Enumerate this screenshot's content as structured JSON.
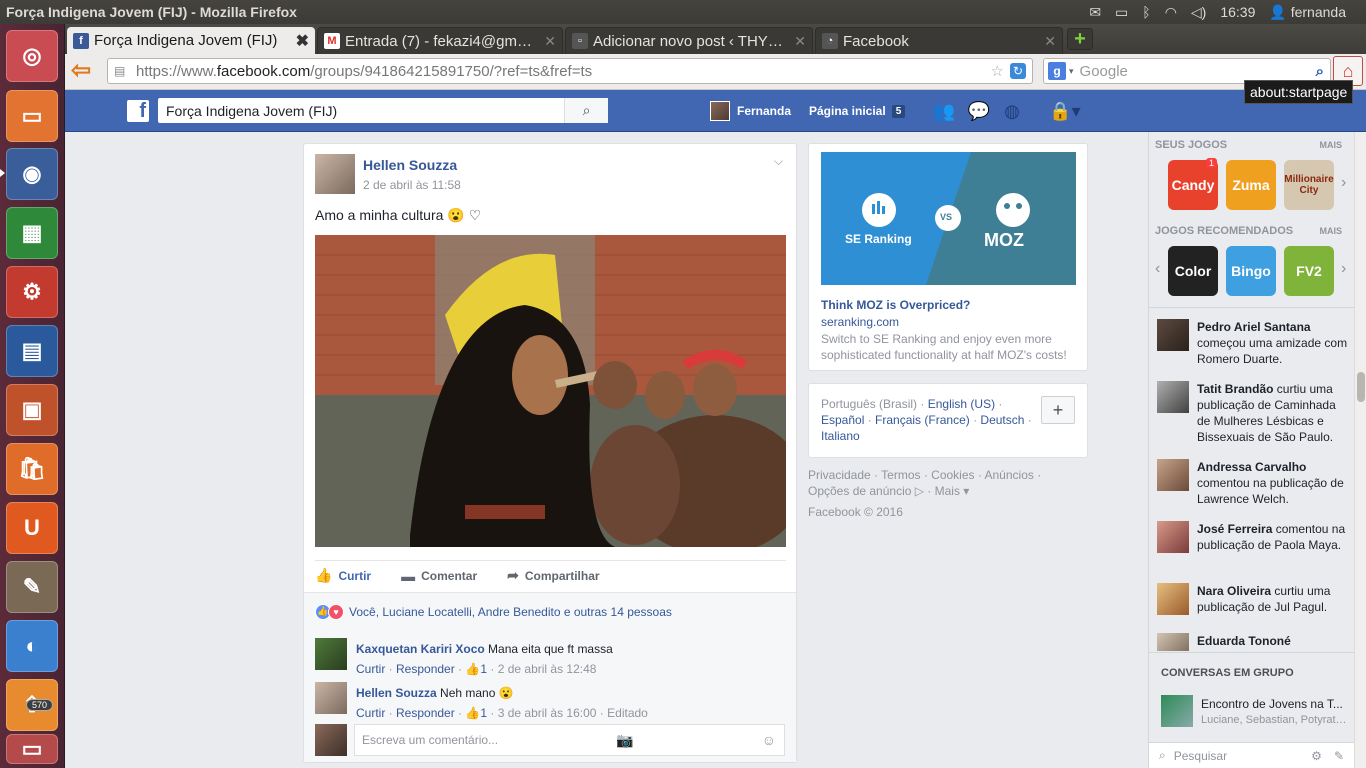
{
  "window": {
    "title": "Força Indigena Jovem (FIJ) - Mozilla Firefox"
  },
  "indicators": {
    "time": "16:39",
    "user": "fernanda"
  },
  "launcher": {
    "badge": "570"
  },
  "tabs": [
    {
      "label": "Força Indigena Jovem (FIJ)",
      "active": true,
      "favicon": "facebook-icon"
    },
    {
      "label": "Entrada (7) - fekazi4@gmail...",
      "active": false,
      "favicon": "gmail-icon"
    },
    {
      "label": "Adicionar novo post ‹ THYD...",
      "active": false,
      "favicon": "wordpress-icon"
    },
    {
      "label": "Facebook",
      "active": false,
      "favicon": "facebook-icon"
    }
  ],
  "nav": {
    "url_prefix": "https://www.",
    "url_domain": "facebook.com",
    "url_path": "/groups/941864215891750/?ref=ts&fref=ts",
    "search_placeholder": "Google",
    "tooltip": "about:startpage"
  },
  "fb": {
    "search_value": "Força Indigena Jovem (FIJ)",
    "user_name": "Fernanda",
    "home_label": "Página inicial",
    "home_count": "5"
  },
  "post": {
    "author": "Hellen Souzza",
    "time": "2 de abril às 11:58",
    "message": "Amo a minha cultura 😮 ♡",
    "actions": {
      "like": "Curtir",
      "comment": "Comentar",
      "share": "Compartilhar"
    },
    "likes_text": "Você, Luciane Locatelli, Andre Benedito e outras 14 pessoas",
    "comments": [
      {
        "name": "Kaxquetan Kariri Xoco",
        "text": "Mana eita que ft massa",
        "reply": "Responder",
        "like": "Curtir",
        "count": "1",
        "time": "2 de abril às 12:48",
        "edited": ""
      },
      {
        "name": "Hellen Souzza",
        "text": "Neh mano 😮",
        "reply": "Responder",
        "like": "Curtir",
        "count": "1",
        "time": "3 de abril às 16:00",
        "edited": "Editado"
      }
    ],
    "comment_placeholder": "Escreva um comentário..."
  },
  "ad": {
    "left_brand": "SE Ranking",
    "vs": "VS",
    "right_brand": "MOZ",
    "title": "Think MOZ is Overpriced?",
    "domain": "seranking.com",
    "body": "Switch to SE Ranking and enjoy even more sophisticated functionality at half MOZ's costs!"
  },
  "languages": {
    "current": "Português (Brasil)",
    "items": [
      "English (US)",
      "Español",
      "Français (France)",
      "Deutsch",
      "Italiano"
    ]
  },
  "footer": {
    "line1": "Privacidade · Termos · Cookies · Anúncios ·",
    "line2": "Opções de anúncio ▷ · Mais ▾",
    "copyright": "Facebook © 2016"
  },
  "sidebar": {
    "your_games": "SEUS JOGOS",
    "more": "MAIS",
    "recommended": "JOGOS RECOMENDADOS",
    "games1": [
      {
        "name": "Candy",
        "color": "#e8412c",
        "badge": "1"
      },
      {
        "name": "Zuma",
        "color": "#f0a01f"
      },
      {
        "name": "Millionaire City",
        "color": "#d6c7b1"
      }
    ],
    "games2": [
      {
        "name": "Color",
        "color": "#222222"
      },
      {
        "name": "Bingo",
        "color": "#3ea0e0"
      },
      {
        "name": "FV2",
        "color": "#7fb33a"
      }
    ],
    "ticker": [
      {
        "name": "Pedro Ariel Santana",
        "text": "começou uma amizade com Romero Duarte."
      },
      {
        "name": "Tatit Brandão",
        "text": "curtiu uma publicação de Caminhada de Mulheres Lésbicas e Bissexuais de São Paulo."
      },
      {
        "name": "Andressa Carvalho",
        "text": "comentou na publicação de Lawrence Welch."
      },
      {
        "name": "José Ferreira",
        "text": "comentou na publicação de Paola Maya."
      },
      {
        "name": "Nara Oliveira",
        "text": "curtiu uma publicação de Jul Pagul."
      },
      {
        "name": "Eduarda Tononé",
        "text": ""
      }
    ],
    "conv_header": "CONVERSAS EM GRUPO",
    "conv_name": "Encontro de Jovens na T...",
    "conv_sub": "Luciane, Sebastian, Potyraté, ...",
    "search_placeholder": "Pesquisar"
  }
}
